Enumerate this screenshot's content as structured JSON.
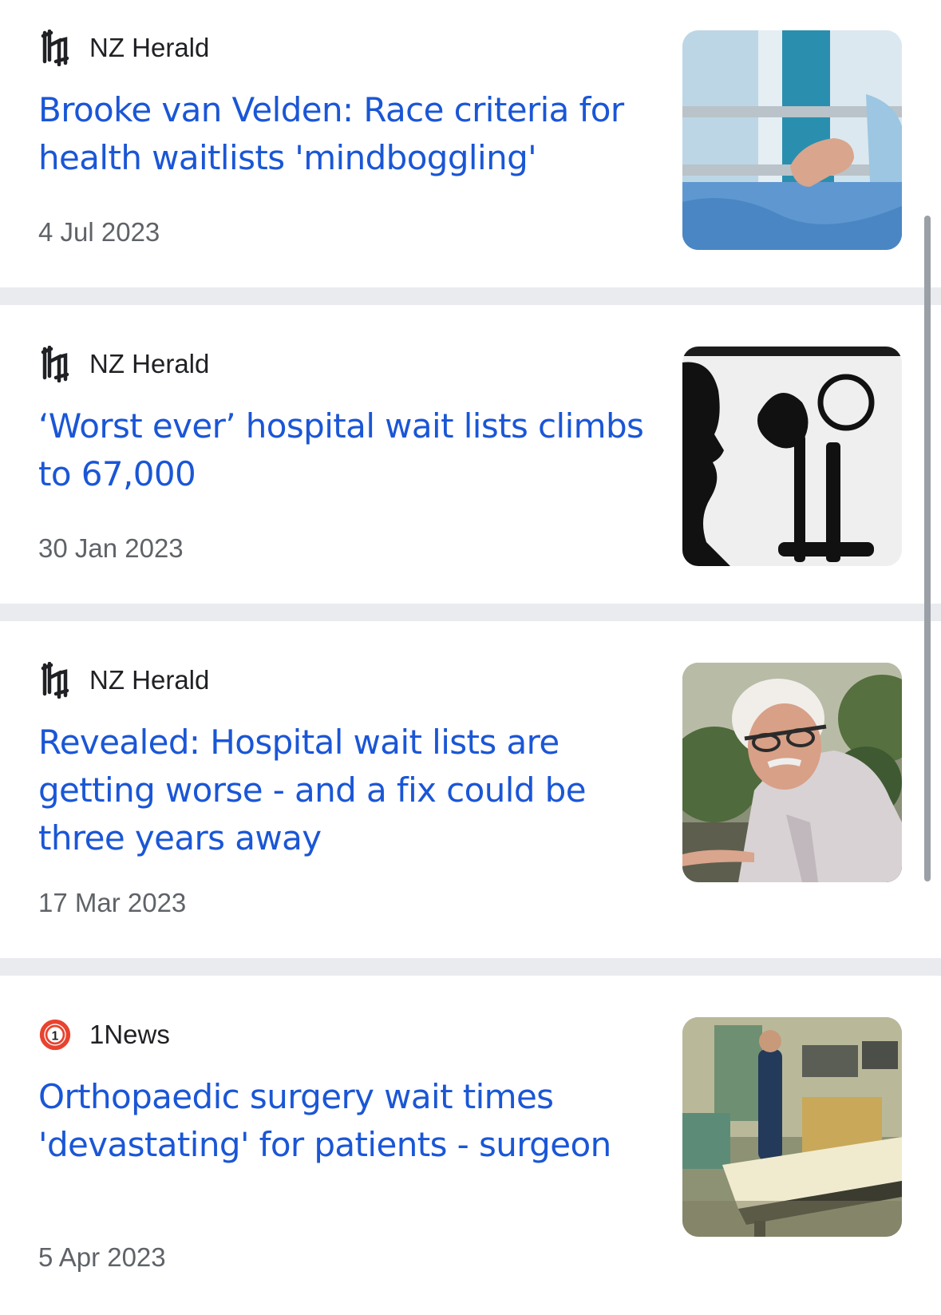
{
  "articles": [
    {
      "source": "NZ Herald",
      "source_icon": "nz-herald-logo-icon",
      "headline": "Brooke van Velden: Race criteria for health waitlists 'mindboggling'",
      "date": "4 Jul 2023",
      "thumbnail": "hospital-bed-patient-hand"
    },
    {
      "source": "NZ Herald",
      "source_icon": "nz-herald-logo-icon",
      "headline": "‘Worst ever’ hospital wait lists climbs to 67,000",
      "date": "30 Jan 2023",
      "thumbnail": "silhouette-with-medical-instruments"
    },
    {
      "source": "NZ Herald",
      "source_icon": "nz-herald-logo-icon",
      "headline": "Revealed: Hospital wait lists are getting worse - and a fix could be three years away",
      "date": "17 Mar 2023",
      "thumbnail": "older-man-with-glasses"
    },
    {
      "source": "1News",
      "source_icon": "one-news-logo-icon",
      "headline": "Orthopaedic surgery wait times 'devastating' for patients - surgeon",
      "date": "5 Apr 2023",
      "thumbnail": "operating-theatre"
    }
  ],
  "colors": {
    "headline": "#1a56d6",
    "source": "#202124",
    "date": "#5f6368",
    "divider": "#e9ebee",
    "one_news_red": "#e8432f"
  }
}
